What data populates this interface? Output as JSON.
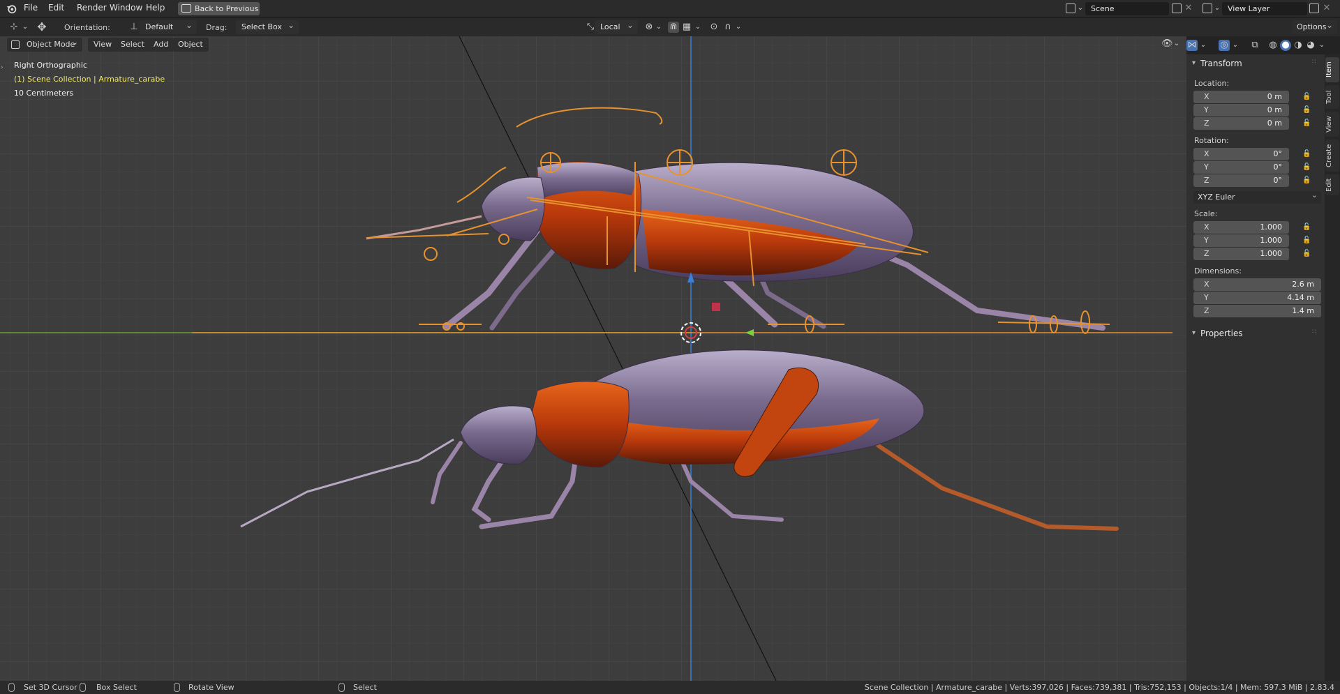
{
  "menubar": {
    "items": [
      "File",
      "Edit",
      "Render",
      "Window",
      "Help"
    ],
    "back_button": "Back to Previous",
    "scene_name": "Scene",
    "view_layer": "View Layer"
  },
  "header": {
    "orientation_label": "Orientation:",
    "orientation_value": "Default",
    "drag_label": "Drag:",
    "drag_value": "Select Box",
    "pivot_value": "Local",
    "options_label": "Options"
  },
  "modebar": {
    "mode": "Object Mode",
    "menus": [
      "View",
      "Select",
      "Add",
      "Object"
    ]
  },
  "viewport": {
    "view_name": "Right Orthographic",
    "collection": "(1) Scene Collection | Armature_carabe",
    "scale": "10 Centimeters"
  },
  "sidebar": {
    "tabs": [
      "Item",
      "Tool",
      "View",
      "Create",
      "Edit"
    ],
    "transform_title": "Transform",
    "location_label": "Location:",
    "location": [
      {
        "axis": "X",
        "value": "0 m"
      },
      {
        "axis": "Y",
        "value": "0 m"
      },
      {
        "axis": "Z",
        "value": "0 m"
      }
    ],
    "rotation_label": "Rotation:",
    "rotation": [
      {
        "axis": "X",
        "value": "0°"
      },
      {
        "axis": "Y",
        "value": "0°"
      },
      {
        "axis": "Z",
        "value": "0°"
      }
    ],
    "rotation_mode": "XYZ Euler",
    "scale_label": "Scale:",
    "scale": [
      {
        "axis": "X",
        "value": "1.000"
      },
      {
        "axis": "Y",
        "value": "1.000"
      },
      {
        "axis": "Z",
        "value": "1.000"
      }
    ],
    "dimensions_label": "Dimensions:",
    "dimensions": [
      {
        "axis": "X",
        "value": "2.6 m"
      },
      {
        "axis": "Y",
        "value": "4.14 m"
      },
      {
        "axis": "Z",
        "value": "1.4 m"
      }
    ],
    "properties_title": "Properties"
  },
  "statusbar": {
    "set_cursor": "Set 3D Cursor",
    "box_select": "Box Select",
    "rotate_view": "Rotate View",
    "select": "Select",
    "stats": "Scene Collection | Armature_carabe | Verts:397,026 | Faces:739,381 | Tris:752,153 | Objects:1/4 | Mem: 597.3 MiB | 2.83.4"
  },
  "colors": {
    "armature": "#e8922e",
    "beetle_body": "#8a7a9a",
    "beetle_orange": "#c2450f",
    "x_axis": "#6aa630",
    "z_axis": "#3b7fd6",
    "selection": "#f5e96a"
  }
}
